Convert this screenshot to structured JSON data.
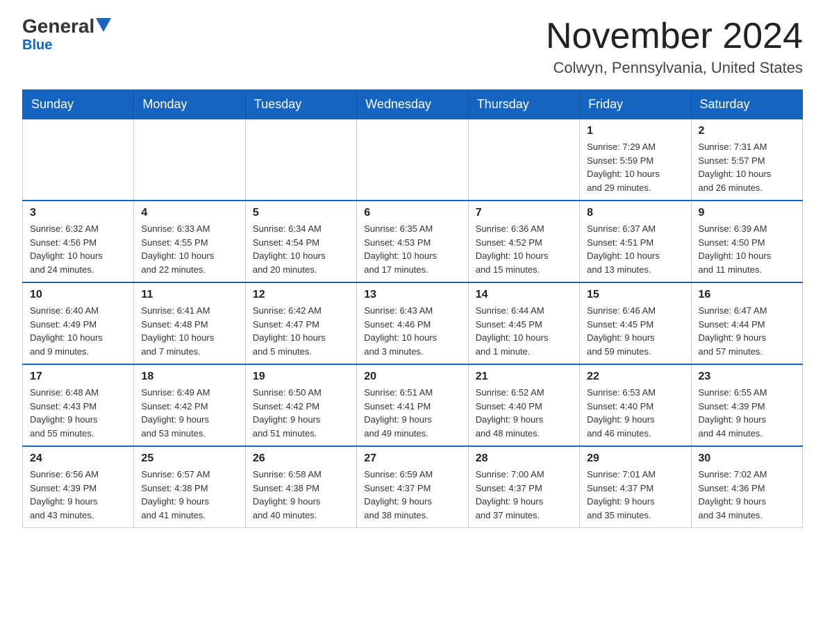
{
  "header": {
    "logo_general": "General",
    "logo_blue": "Blue",
    "main_title": "November 2024",
    "subtitle": "Colwyn, Pennsylvania, United States"
  },
  "weekdays": [
    "Sunday",
    "Monday",
    "Tuesday",
    "Wednesday",
    "Thursday",
    "Friday",
    "Saturday"
  ],
  "weeks": [
    [
      {
        "day": "",
        "info": ""
      },
      {
        "day": "",
        "info": ""
      },
      {
        "day": "",
        "info": ""
      },
      {
        "day": "",
        "info": ""
      },
      {
        "day": "",
        "info": ""
      },
      {
        "day": "1",
        "info": "Sunrise: 7:29 AM\nSunset: 5:59 PM\nDaylight: 10 hours\nand 29 minutes."
      },
      {
        "day": "2",
        "info": "Sunrise: 7:31 AM\nSunset: 5:57 PM\nDaylight: 10 hours\nand 26 minutes."
      }
    ],
    [
      {
        "day": "3",
        "info": "Sunrise: 6:32 AM\nSunset: 4:56 PM\nDaylight: 10 hours\nand 24 minutes."
      },
      {
        "day": "4",
        "info": "Sunrise: 6:33 AM\nSunset: 4:55 PM\nDaylight: 10 hours\nand 22 minutes."
      },
      {
        "day": "5",
        "info": "Sunrise: 6:34 AM\nSunset: 4:54 PM\nDaylight: 10 hours\nand 20 minutes."
      },
      {
        "day": "6",
        "info": "Sunrise: 6:35 AM\nSunset: 4:53 PM\nDaylight: 10 hours\nand 17 minutes."
      },
      {
        "day": "7",
        "info": "Sunrise: 6:36 AM\nSunset: 4:52 PM\nDaylight: 10 hours\nand 15 minutes."
      },
      {
        "day": "8",
        "info": "Sunrise: 6:37 AM\nSunset: 4:51 PM\nDaylight: 10 hours\nand 13 minutes."
      },
      {
        "day": "9",
        "info": "Sunrise: 6:39 AM\nSunset: 4:50 PM\nDaylight: 10 hours\nand 11 minutes."
      }
    ],
    [
      {
        "day": "10",
        "info": "Sunrise: 6:40 AM\nSunset: 4:49 PM\nDaylight: 10 hours\nand 9 minutes."
      },
      {
        "day": "11",
        "info": "Sunrise: 6:41 AM\nSunset: 4:48 PM\nDaylight: 10 hours\nand 7 minutes."
      },
      {
        "day": "12",
        "info": "Sunrise: 6:42 AM\nSunset: 4:47 PM\nDaylight: 10 hours\nand 5 minutes."
      },
      {
        "day": "13",
        "info": "Sunrise: 6:43 AM\nSunset: 4:46 PM\nDaylight: 10 hours\nand 3 minutes."
      },
      {
        "day": "14",
        "info": "Sunrise: 6:44 AM\nSunset: 4:45 PM\nDaylight: 10 hours\nand 1 minute."
      },
      {
        "day": "15",
        "info": "Sunrise: 6:46 AM\nSunset: 4:45 PM\nDaylight: 9 hours\nand 59 minutes."
      },
      {
        "day": "16",
        "info": "Sunrise: 6:47 AM\nSunset: 4:44 PM\nDaylight: 9 hours\nand 57 minutes."
      }
    ],
    [
      {
        "day": "17",
        "info": "Sunrise: 6:48 AM\nSunset: 4:43 PM\nDaylight: 9 hours\nand 55 minutes."
      },
      {
        "day": "18",
        "info": "Sunrise: 6:49 AM\nSunset: 4:42 PM\nDaylight: 9 hours\nand 53 minutes."
      },
      {
        "day": "19",
        "info": "Sunrise: 6:50 AM\nSunset: 4:42 PM\nDaylight: 9 hours\nand 51 minutes."
      },
      {
        "day": "20",
        "info": "Sunrise: 6:51 AM\nSunset: 4:41 PM\nDaylight: 9 hours\nand 49 minutes."
      },
      {
        "day": "21",
        "info": "Sunrise: 6:52 AM\nSunset: 4:40 PM\nDaylight: 9 hours\nand 48 minutes."
      },
      {
        "day": "22",
        "info": "Sunrise: 6:53 AM\nSunset: 4:40 PM\nDaylight: 9 hours\nand 46 minutes."
      },
      {
        "day": "23",
        "info": "Sunrise: 6:55 AM\nSunset: 4:39 PM\nDaylight: 9 hours\nand 44 minutes."
      }
    ],
    [
      {
        "day": "24",
        "info": "Sunrise: 6:56 AM\nSunset: 4:39 PM\nDaylight: 9 hours\nand 43 minutes."
      },
      {
        "day": "25",
        "info": "Sunrise: 6:57 AM\nSunset: 4:38 PM\nDaylight: 9 hours\nand 41 minutes."
      },
      {
        "day": "26",
        "info": "Sunrise: 6:58 AM\nSunset: 4:38 PM\nDaylight: 9 hours\nand 40 minutes."
      },
      {
        "day": "27",
        "info": "Sunrise: 6:59 AM\nSunset: 4:37 PM\nDaylight: 9 hours\nand 38 minutes."
      },
      {
        "day": "28",
        "info": "Sunrise: 7:00 AM\nSunset: 4:37 PM\nDaylight: 9 hours\nand 37 minutes."
      },
      {
        "day": "29",
        "info": "Sunrise: 7:01 AM\nSunset: 4:37 PM\nDaylight: 9 hours\nand 35 minutes."
      },
      {
        "day": "30",
        "info": "Sunrise: 7:02 AM\nSunset: 4:36 PM\nDaylight: 9 hours\nand 34 minutes."
      }
    ]
  ]
}
